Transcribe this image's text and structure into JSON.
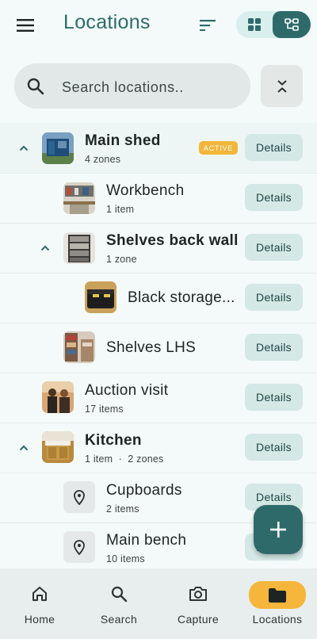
{
  "appbar": {
    "title": "Locations"
  },
  "search": {
    "placeholder": "Search locations.."
  },
  "details_label": "Details",
  "rows": [
    {
      "name": "Main shed",
      "sub": "4 zones",
      "badge": "ACTIVE"
    },
    {
      "name": "Workbench",
      "sub": "1 item"
    },
    {
      "name": "Shelves back wall",
      "sub": "1 zone"
    },
    {
      "name": "Black storage...",
      "sub": ""
    },
    {
      "name": "Shelves LHS",
      "sub": ""
    },
    {
      "name": "Auction visit",
      "sub": "17 items"
    },
    {
      "name": "Kitchen",
      "sub": "1 item  ·  2 zones"
    },
    {
      "name": "Cupboards",
      "sub": "2 items"
    },
    {
      "name": "Main bench",
      "sub": "10 items"
    }
  ],
  "nav": [
    {
      "label": "Home",
      "icon": "home-icon"
    },
    {
      "label": "Search",
      "icon": "search-icon"
    },
    {
      "label": "Capture",
      "icon": "camera-icon"
    },
    {
      "label": "Locations",
      "icon": "folder-icon"
    }
  ],
  "colors": {
    "accent": "#2e6a6a",
    "badge": "#f2b63a",
    "details_bg": "#d4e8e6"
  }
}
